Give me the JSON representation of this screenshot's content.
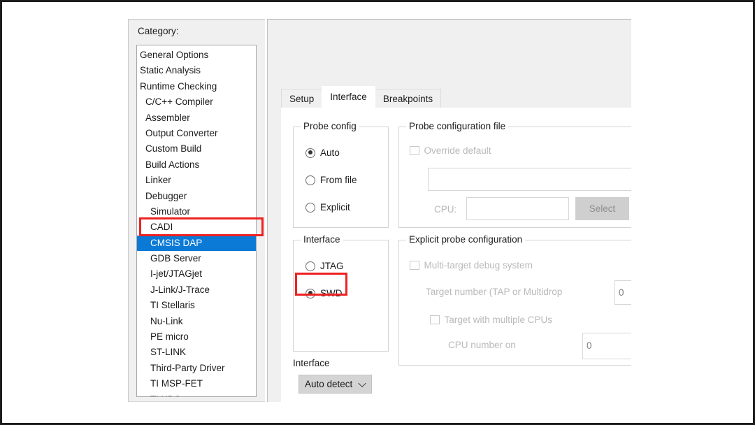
{
  "dialog": {
    "category_label": "Category:",
    "categories": [
      {
        "label": "General Options",
        "indent": 0,
        "selected": false
      },
      {
        "label": "Static Analysis",
        "indent": 0,
        "selected": false
      },
      {
        "label": "Runtime Checking",
        "indent": 0,
        "selected": false
      },
      {
        "label": "C/C++ Compiler",
        "indent": 1,
        "selected": false
      },
      {
        "label": "Assembler",
        "indent": 1,
        "selected": false
      },
      {
        "label": "Output Converter",
        "indent": 1,
        "selected": false
      },
      {
        "label": "Custom Build",
        "indent": 1,
        "selected": false
      },
      {
        "label": "Build Actions",
        "indent": 1,
        "selected": false
      },
      {
        "label": "Linker",
        "indent": 1,
        "selected": false
      },
      {
        "label": "Debugger",
        "indent": 1,
        "selected": false
      },
      {
        "label": "Simulator",
        "indent": 2,
        "selected": false
      },
      {
        "label": "CADI",
        "indent": 2,
        "selected": false
      },
      {
        "label": "CMSIS DAP",
        "indent": 2,
        "selected": true
      },
      {
        "label": "GDB Server",
        "indent": 2,
        "selected": false
      },
      {
        "label": "I-jet/JTAGjet",
        "indent": 2,
        "selected": false
      },
      {
        "label": "J-Link/J-Trace",
        "indent": 2,
        "selected": false
      },
      {
        "label": "TI Stellaris",
        "indent": 2,
        "selected": false
      },
      {
        "label": "Nu-Link",
        "indent": 2,
        "selected": false
      },
      {
        "label": "PE micro",
        "indent": 2,
        "selected": false
      },
      {
        "label": "ST-LINK",
        "indent": 2,
        "selected": false
      },
      {
        "label": "Third-Party Driver",
        "indent": 2,
        "selected": false
      },
      {
        "label": "TI MSP-FET",
        "indent": 2,
        "selected": false
      },
      {
        "label": "TI XDS",
        "indent": 2,
        "selected": false
      }
    ]
  },
  "tabs": [
    {
      "label": "Setup",
      "active": false
    },
    {
      "label": "Interface",
      "active": true
    },
    {
      "label": "Breakpoints",
      "active": false
    }
  ],
  "probe_config": {
    "legend": "Probe config",
    "options": [
      {
        "label": "Auto",
        "selected": true
      },
      {
        "label": "From file",
        "selected": false
      },
      {
        "label": "Explicit",
        "selected": false
      }
    ]
  },
  "interface_group": {
    "legend": "Interface",
    "options": [
      {
        "label": "JTAG",
        "selected": false
      },
      {
        "label": "SWD",
        "selected": true
      }
    ]
  },
  "interface_combo": {
    "label": "Interface",
    "value": "Auto detect"
  },
  "probe_file": {
    "legend": "Probe configuration file",
    "override_label": "Override default",
    "override_checked": false,
    "path_value": "",
    "cpu_label": "CPU:",
    "cpu_value": "",
    "select_button": "Select"
  },
  "explicit": {
    "legend": "Explicit probe configuration",
    "multi_target_label": "Multi-target debug system",
    "multi_target_checked": false,
    "target_number_label": "Target number (TAP or Multidrop",
    "target_number_value": "0",
    "multiple_cpus_label": "Target with multiple CPUs",
    "multiple_cpus_checked": false,
    "cpu_number_label": "CPU number on",
    "cpu_number_value": "0"
  },
  "annotations": {
    "color": "#ee2222",
    "highlight_selected_category": "CMSIS DAP",
    "highlight_interface_option": "SWD"
  },
  "colors": {
    "selection_blue": "#0b7ad6",
    "panel_gray": "#f0f0f0",
    "annotation_red": "#ee2222"
  }
}
